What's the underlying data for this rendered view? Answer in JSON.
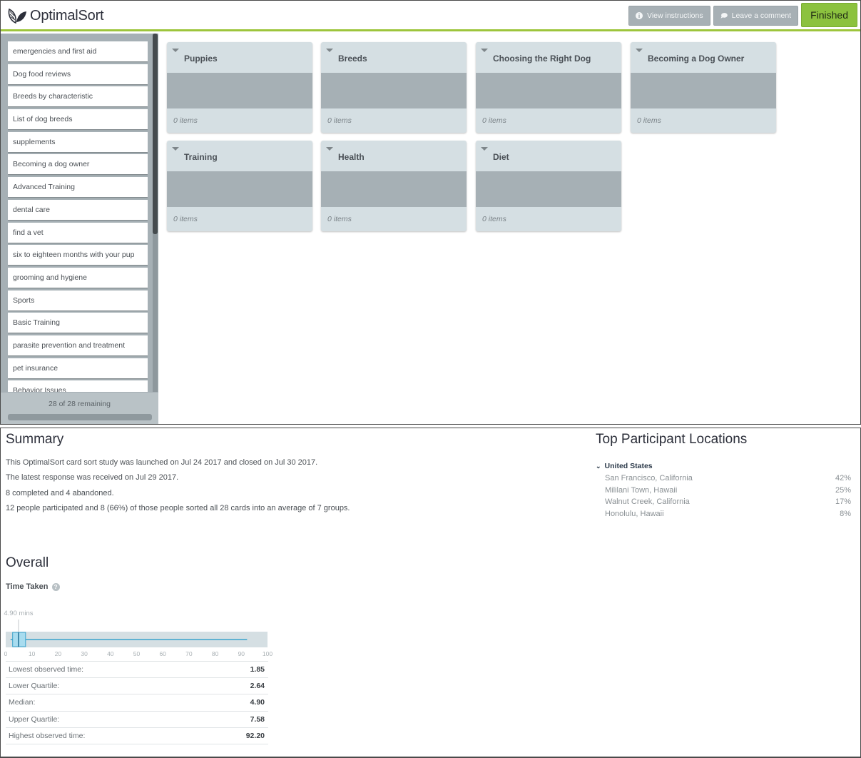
{
  "app": {
    "name": "OptimalSort",
    "logo_icon": "leaf-icon",
    "accent_color": "#9dc53c",
    "buttons": {
      "view_instructions": {
        "label": "View instructions",
        "icon": "info-icon"
      },
      "leave_comment": {
        "label": "Leave a comment",
        "icon": "speech-bubble-icon"
      },
      "finished": {
        "label": "Finished"
      }
    }
  },
  "cards": {
    "items": [
      "emergencies and first aid",
      "Dog food reviews",
      "Breeds by characteristic",
      "List of dog breeds",
      "supplements",
      "Becoming a dog owner",
      "Advanced Training",
      "dental care",
      "find a vet",
      "six to eighteen months with your pup",
      "grooming and hygiene",
      "Sports",
      "Basic Training",
      "parasite prevention and treatment",
      "pet insurance",
      "Behavior Issues"
    ],
    "remaining_text": "28 of 28 remaining",
    "remaining": 28,
    "total": 28,
    "sorted_fraction": 0
  },
  "groups": [
    {
      "title": "Puppies",
      "count_text": "0 items"
    },
    {
      "title": "Breeds",
      "count_text": "0 items"
    },
    {
      "title": "Choosing the Right Dog",
      "count_text": "0 items"
    },
    {
      "title": "Becoming a Dog Owner",
      "count_text": "0 items"
    },
    {
      "title": "Training",
      "count_text": "0 items"
    },
    {
      "title": "Health",
      "count_text": "0 items"
    },
    {
      "title": "Diet",
      "count_text": "0 items"
    }
  ],
  "summary": {
    "title": "Summary",
    "lines": [
      "This OptimalSort card sort study was launched on Jul 24 2017 and closed on Jul 30 2017.",
      "The latest response was received on Jul 29 2017.",
      "8 completed and 4 abandoned.",
      "12 people participated and 8 (66%) of those people sorted all 28 cards into an average of 7 groups."
    ]
  },
  "locations": {
    "title": "Top Participant Locations",
    "country": "United States",
    "rows": [
      {
        "place": "San Francisco, California",
        "pct": "42%"
      },
      {
        "place": "Mililani Town, Hawaii",
        "pct": "25%"
      },
      {
        "place": "Walnut Creek, California",
        "pct": "17%"
      },
      {
        "place": "Honolulu, Hawaii",
        "pct": "8%"
      }
    ]
  },
  "overall": {
    "title": "Overall",
    "time_taken_label": "Time Taken",
    "median_marker_label": "4.90 mins",
    "axis": {
      "min": 0,
      "max": 100,
      "ticks": [
        0,
        10,
        20,
        30,
        40,
        50,
        60,
        70,
        80,
        90,
        100
      ]
    },
    "boxplot": {
      "min": 1.85,
      "q1": 2.64,
      "median": 4.9,
      "q3": 7.58,
      "max": 92.2
    },
    "stats": [
      {
        "label": "Lowest observed time:",
        "value": "1.85"
      },
      {
        "label": "Lower Quartile:",
        "value": "2.64"
      },
      {
        "label": "Median:",
        "value": "4.90"
      },
      {
        "label": "Upper Quartile:",
        "value": "7.58"
      },
      {
        "label": "Highest observed time:",
        "value": "92.20"
      }
    ]
  },
  "colors": {
    "box_fill": "#a8dcef",
    "box_stroke": "#3aa3cc",
    "plot_bg": "#d5dfe3",
    "tick_text": "#a9b0b4"
  }
}
